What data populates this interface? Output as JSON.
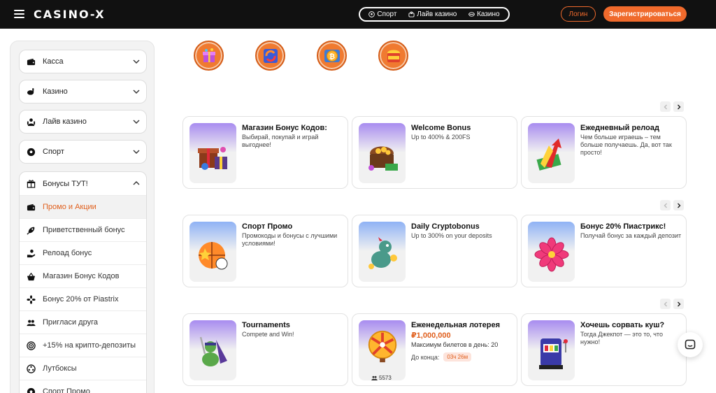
{
  "header": {
    "logo": "CASINO-X",
    "nav": [
      {
        "label": "Спорт",
        "icon": "soccer-ball-icon"
      },
      {
        "label": "Лайв казино",
        "icon": "live-casino-icon"
      },
      {
        "label": "Казино",
        "icon": "casino-chip-icon"
      }
    ],
    "login_label": "Логин",
    "register_label": "Зарегистрироваться"
  },
  "sidebar": {
    "groups": [
      {
        "label": "Касса",
        "icon": "wallet-icon"
      },
      {
        "label": "Казино",
        "icon": "slot-icon"
      },
      {
        "label": "Лайв казино",
        "icon": "live-casino-icon"
      },
      {
        "label": "Спорт",
        "icon": "soccer-ball-icon"
      }
    ],
    "bonus_group": {
      "label": "Бонусы ТУТ!",
      "icon": "gift-icon",
      "items": [
        {
          "label": "Промо и Акции",
          "icon": "wallet-icon",
          "active": true
        },
        {
          "label": "Приветственный бонус",
          "icon": "rocket-icon"
        },
        {
          "label": "Релоад бонус",
          "icon": "hand-coin-icon"
        },
        {
          "label": "Магазин Бонус Кодов",
          "icon": "basket-icon"
        },
        {
          "label": "Бонус 20% от Piastrix",
          "icon": "flower-icon"
        },
        {
          "label": "Пригласи друга",
          "icon": "users-icon"
        },
        {
          "label": "+15% на крипто-депозиты",
          "icon": "target-icon"
        },
        {
          "label": "Лутбоксы",
          "icon": "reel-icon"
        },
        {
          "label": "Спорт Промо",
          "icon": "soccer-ball-icon"
        }
      ]
    }
  },
  "round_icons": [
    "gift-box-icon",
    "refresh-icon",
    "bitcoin-icon",
    "bonus-chest-icon"
  ],
  "cards": [
    {
      "title": "Магазин Бонус Кодов:",
      "desc": "Выбирай, покупай и играй выгоднее!",
      "art": "gift-boxes-icon",
      "grad": "#a88cf0"
    },
    {
      "title": "Welcome Bonus",
      "desc": "Up to 400% & 200FS",
      "art": "treasure-chest-icon",
      "grad": "#a88cf0"
    },
    {
      "title": "Ежедневный релоад",
      "desc": "Чем больше играешь – тем больше получаешь. Да, вот так просто!",
      "art": "money-arrow-icon",
      "grad": "#a88cf0"
    },
    {
      "title": "Спорт Промо",
      "desc": "Промокоды и бонусы с лучшими условиями!",
      "art": "sport-balls-icon",
      "grad": "#8fb2f5"
    },
    {
      "title": "Daily Cryptobonus",
      "desc": "Up to 300% on your deposits",
      "art": "dragon-icon",
      "grad": "#8fb2f5"
    },
    {
      "title": "Бонус 20% Пиастрикс!",
      "desc": "Получай бонус за каждый депозит",
      "art": "flower-icon",
      "grad": "#8fb2f5"
    },
    {
      "title": "Tournaments",
      "desc": "Compete and Win!",
      "art": "warrior-icon",
      "grad": "#a88cf0"
    },
    {
      "title": "Еженедельная лотерея",
      "prize": "₽1,000,000",
      "tickets_label": "Максимум билетов в день:",
      "tickets_value": "20",
      "ends_label": "До конца:",
      "timer": "03ч 26м",
      "players": "5573",
      "art": "wheel-icon",
      "grad": "#a88cf0"
    },
    {
      "title": "Хочешь сорвать куш?",
      "desc": "Тогда Джекпот — это то, что нужно!",
      "art": "slot-machine-icon",
      "grad": "#a88cf0"
    }
  ],
  "colors": {
    "accent": "#f06a2c",
    "header_bg": "#111111"
  }
}
